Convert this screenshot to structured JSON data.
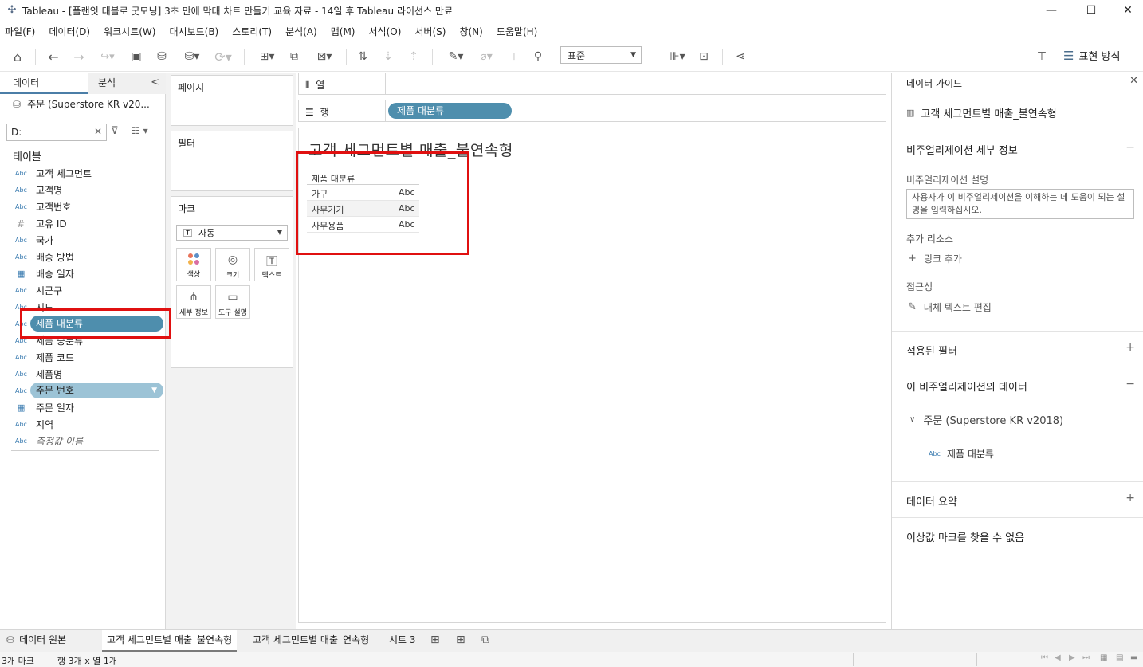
{
  "window": {
    "title": "Tableau - [플랜잇 태블로 굿모닝] 3초 만에 막대 차트 만들기 교육 자료 - 14일 후 Tableau 라이선스 만료",
    "minimize_glyph": "—",
    "maximize_glyph": "☐",
    "close_glyph": "✕"
  },
  "menu": [
    "파일(F)",
    "데이터(D)",
    "워크시트(W)",
    "대시보드(B)",
    "스토리(T)",
    "분석(A)",
    "맵(M)",
    "서식(O)",
    "서버(S)",
    "창(N)",
    "도움말(H)"
  ],
  "toolbar": {
    "fit_value": "표준",
    "show_me_label": "표현 방식"
  },
  "data_pane": {
    "tab_data": "데이터",
    "tab_analysis": "분석",
    "datasource": "주문 (Superstore KR v20...",
    "search_value": "D:",
    "tables_heading": "테이블",
    "fields": [
      {
        "type": "Abc",
        "name": "고객 세그먼트"
      },
      {
        "type": "Abc",
        "name": "고객명"
      },
      {
        "type": "Abc",
        "name": "고객번호"
      },
      {
        "type": "#",
        "name": "고유 ID"
      },
      {
        "type": "Abc",
        "name": "국가"
      },
      {
        "type": "Abc",
        "name": "배송 방법"
      },
      {
        "type": "date",
        "name": "배송 일자"
      },
      {
        "type": "Abc",
        "name": "시군구"
      },
      {
        "type": "Abc",
        "name": "시도"
      },
      {
        "type": "Abc",
        "name": "제품 대분류"
      },
      {
        "type": "Abc",
        "name": "제품 중분류"
      },
      {
        "type": "Abc",
        "name": "제품 코드"
      },
      {
        "type": "Abc",
        "name": "제품명"
      },
      {
        "type": "Abc",
        "name": "주문 번호"
      },
      {
        "type": "date",
        "name": "주문 일자"
      },
      {
        "type": "Abc",
        "name": "지역"
      },
      {
        "type": "Abc",
        "name": "측정값 이름"
      }
    ],
    "dragging_pill": "제품 대분류",
    "selected_pill": "주문 번호"
  },
  "shelves": {
    "pages": "페이지",
    "filters": "필터",
    "marks": "마크",
    "mark_type": "자동",
    "mark_buttons": {
      "color": "색상",
      "size": "크기",
      "text": "텍스트",
      "detail": "세부 정보",
      "tooltip": "도구 설명"
    },
    "columns_label": "열",
    "rows_label": "행",
    "rows_pill": "제품 대분류"
  },
  "viz": {
    "title": "고객 세그먼트별 매출_불연속형",
    "header": "제품 대분류",
    "rows": [
      {
        "category": "가구",
        "value": "Abc"
      },
      {
        "category": "사무기기",
        "value": "Abc"
      },
      {
        "category": "사무용품",
        "value": "Abc"
      }
    ]
  },
  "guide": {
    "header": "데이터 가이드",
    "sheet": "고객 세그먼트별 매출_불연속형",
    "details_heading": "비주얼리제이션 세부 정보",
    "description_label": "비주얼리제이션 설명",
    "description_placeholder": "사용자가 이 비주얼리제이션을 이해하는 데 도움이 되는 설명을 입력하십시오.",
    "resources_label": "추가 리소스",
    "add_link": "링크 추가",
    "accessibility_label": "접근성",
    "edit_alt_text": "대체 텍스트 편집",
    "applied_filters": "적용된 필터",
    "viz_data_heading": "이 비주얼리제이션의 데이터",
    "datasource": "주문 (Superstore KR v2018)",
    "field_type": "Abc",
    "field_name": "제품 대분류",
    "data_summary": "데이터 요약",
    "outliers": "이상값 마크를 찾을 수 없음"
  },
  "tabs": {
    "data_source": "데이터 원본",
    "sheets": [
      "고객 세그먼트별 매출_불연속형",
      "고객 세그먼트별 매출_연속형",
      "시트 3"
    ]
  },
  "status": {
    "marks": "3개 마크",
    "dims": "행 3개  x  열 1개"
  },
  "colors": {
    "pill_dark": "#4e8ead",
    "pill_light": "#9cc3d6",
    "highlight_box": "#e01010"
  }
}
